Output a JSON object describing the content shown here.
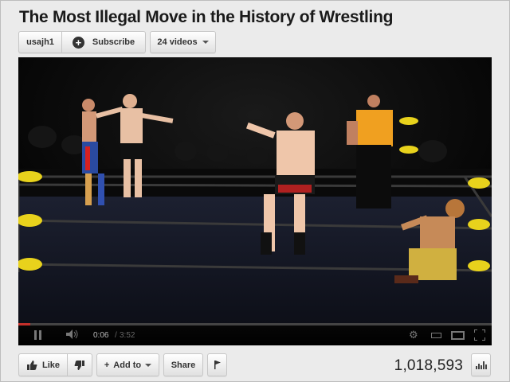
{
  "video": {
    "title": "The Most Illegal Move in the History of Wrestling",
    "view_count": "1,018,593"
  },
  "channel": {
    "username": "usajh1",
    "subscribe_label": "Subscribe",
    "subscribe_icon": "+",
    "videos_label": "24 videos"
  },
  "player": {
    "current_time": "0:06",
    "separator": "/",
    "total_time": "3:52",
    "progress_fraction": 0.026
  },
  "actions": {
    "like_label": "Like",
    "add_to_label": "Add to",
    "add_to_prefix": "+",
    "share_label": "Share"
  },
  "colors": {
    "progress": "#c4302b",
    "referee_shirt": "#f0a020",
    "ring_post_pad": "#e8d21c"
  }
}
